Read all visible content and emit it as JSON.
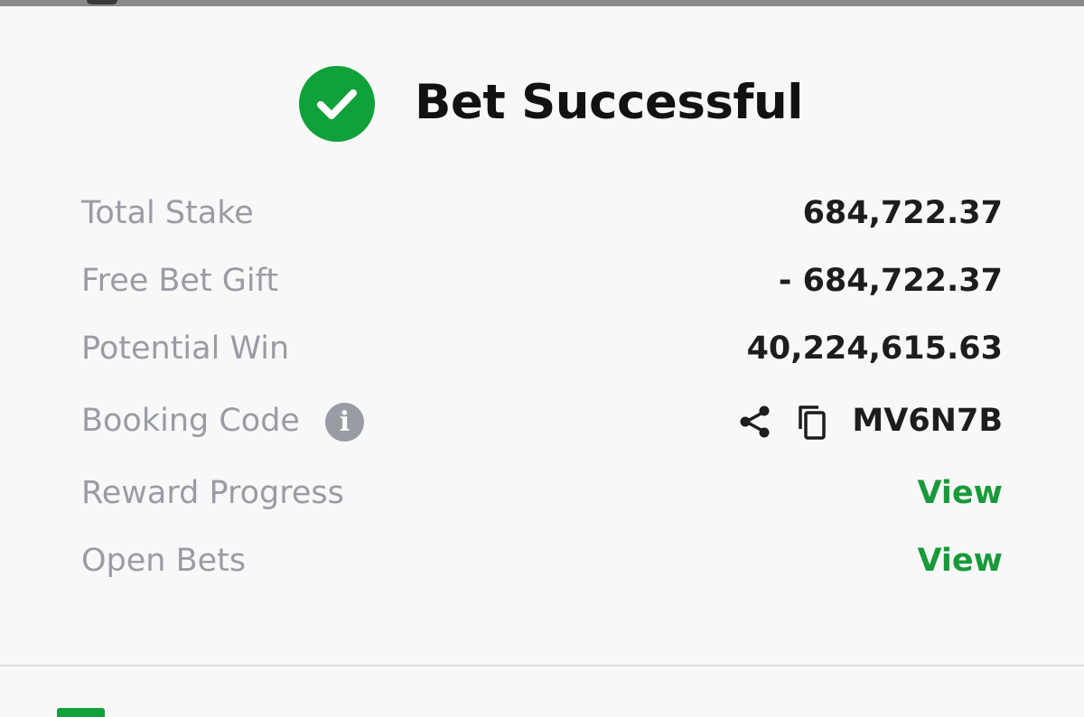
{
  "header": {
    "title": "Bet Successful",
    "icon": "check-circle-icon",
    "icon_color": "#10a13a"
  },
  "rows": [
    {
      "label": "Total Stake",
      "value": "684,722.37"
    },
    {
      "label": "Free Bet Gift",
      "value": "- 684,722.37"
    },
    {
      "label": "Potential Win",
      "value": "40,224,615.63"
    },
    {
      "label": "Booking Code",
      "value": "MV6N7B",
      "info_icon": "i"
    },
    {
      "label": "Reward Progress",
      "value": "View"
    },
    {
      "label": "Open Bets",
      "value": "View"
    }
  ],
  "colors": {
    "accent": "#189a3a",
    "label": "#9a9ca3",
    "value": "#1d1d1f"
  }
}
